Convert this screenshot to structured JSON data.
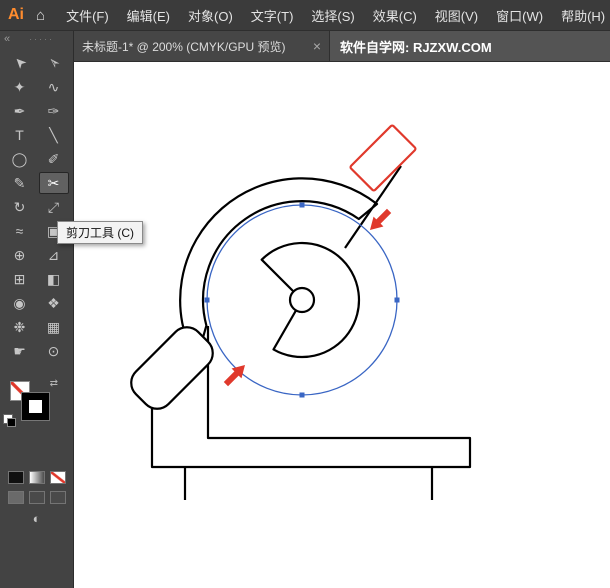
{
  "app": {
    "logo_text": "Ai"
  },
  "menubar": {
    "home_icon": "⌂",
    "workspace_icon": "▦",
    "items": [
      {
        "label": "文件(F)"
      },
      {
        "label": "编辑(E)"
      },
      {
        "label": "对象(O)"
      },
      {
        "label": "文字(T)"
      },
      {
        "label": "选择(S)"
      },
      {
        "label": "效果(C)"
      },
      {
        "label": "视图(V)"
      },
      {
        "label": "窗口(W)"
      },
      {
        "label": "帮助(H)"
      }
    ]
  },
  "tabbar": {
    "tab_title": "未标题-1* @ 200% (CMYK/GPU 预览)",
    "close_icon": "×",
    "watermark": "软件自学网: RJZXW.COM"
  },
  "toolbar": {
    "collapse_icon": "«",
    "grip_icon": "·····",
    "swap_icon": "⇄",
    "screen_mode_icon": "◐",
    "tools": [
      {
        "name": "selection",
        "glyph": "➤"
      },
      {
        "name": "direct-selection",
        "glyph": "➢"
      },
      {
        "name": "magic-wand",
        "glyph": "✦"
      },
      {
        "name": "lasso",
        "glyph": "∿"
      },
      {
        "name": "pen",
        "glyph": "✒"
      },
      {
        "name": "curvature",
        "glyph": "✑"
      },
      {
        "name": "type",
        "glyph": "T"
      },
      {
        "name": "line-segment",
        "glyph": "╲"
      },
      {
        "name": "ellipse",
        "glyph": "◯"
      },
      {
        "name": "paintbrush",
        "glyph": "✐"
      },
      {
        "name": "pencil",
        "glyph": "✎"
      },
      {
        "name": "scissors",
        "glyph": "✂",
        "selected": true
      },
      {
        "name": "rotate",
        "glyph": "↻"
      },
      {
        "name": "scale",
        "glyph": "⤢"
      },
      {
        "name": "width",
        "glyph": "≈"
      },
      {
        "name": "free-transform",
        "glyph": "▣"
      },
      {
        "name": "shape-builder",
        "glyph": "⊕"
      },
      {
        "name": "perspective-grid",
        "glyph": "⊿"
      },
      {
        "name": "mesh",
        "glyph": "⊞"
      },
      {
        "name": "gradient",
        "glyph": "◧"
      },
      {
        "name": "eyedropper",
        "glyph": "◉"
      },
      {
        "name": "blend",
        "glyph": "❖"
      },
      {
        "name": "symbol-sprayer",
        "glyph": "❉"
      },
      {
        "name": "column-graph",
        "glyph": "▦"
      },
      {
        "name": "hand",
        "glyph": "☛"
      },
      {
        "name": "zoom",
        "glyph": "⊙"
      }
    ]
  },
  "tooltip": {
    "text": "剪刀工具 (C)"
  },
  "canvas": {
    "colors": {
      "selection_blue": "#3A66C4",
      "arrow_red": "#E0392C",
      "artwork_black": "#000000"
    }
  }
}
